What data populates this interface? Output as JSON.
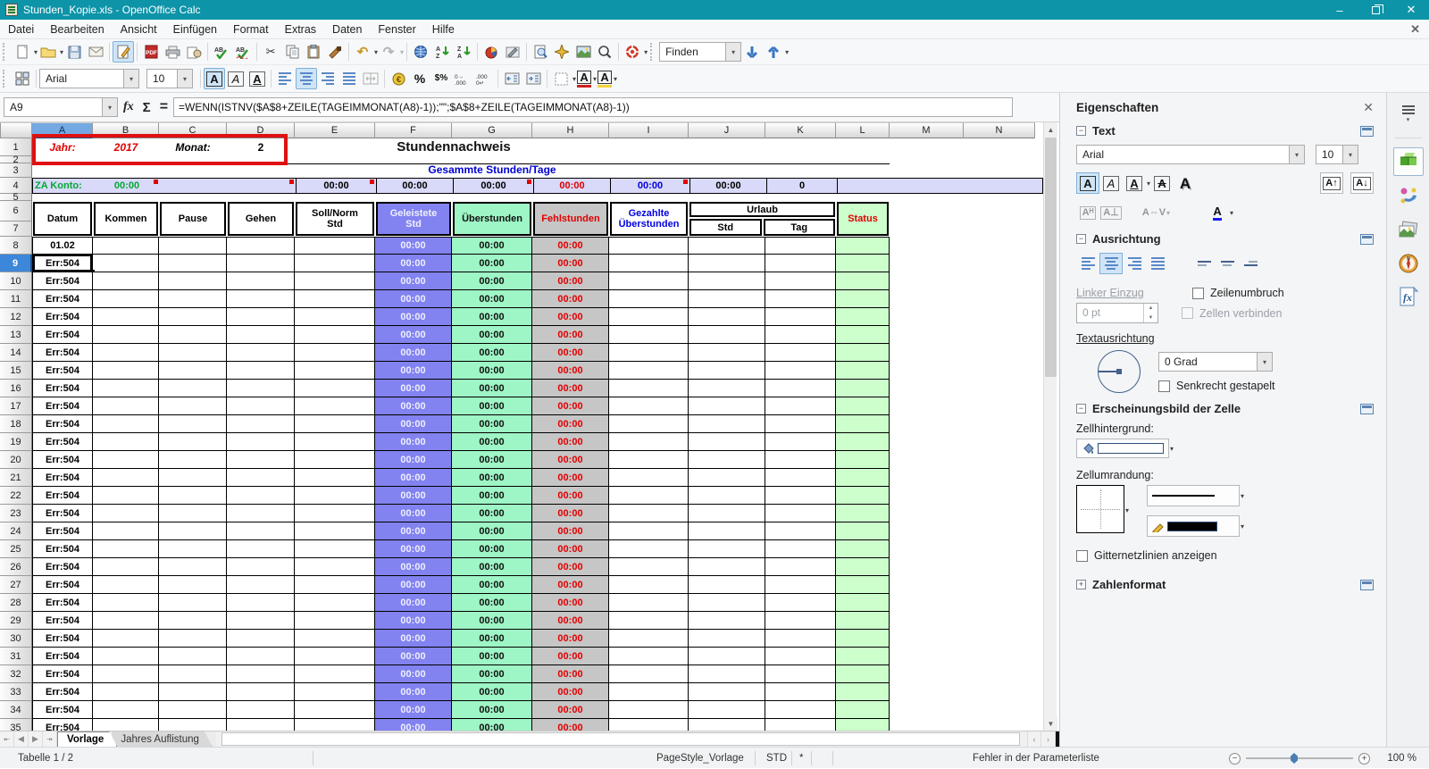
{
  "window": {
    "title": "Stunden_Kopie.xls - OpenOffice Calc"
  },
  "menu": {
    "items": [
      "Datei",
      "Bearbeiten",
      "Ansicht",
      "Einfügen",
      "Format",
      "Extras",
      "Daten",
      "Fenster",
      "Hilfe"
    ]
  },
  "toolbar1": {
    "find_placeholder": "Finden",
    "pdf_label": "PDF",
    "spell_label": "ABC"
  },
  "toolbar2": {
    "font_name": "Arial",
    "font_size": "10",
    "percent": "%",
    "currency_percent": "$%",
    "add_decimal": "000",
    "del_decimal": "000"
  },
  "formula_bar": {
    "cell_ref": "A9",
    "fx": "fx",
    "sum": "Σ",
    "equals": "=",
    "formula": "=WENN(ISTNV($A$8+ZEILE(TAGEIMMONAT(A8)-1));\"\";$A$8+ZEILE(TAGEIMMONAT(A8)-1))"
  },
  "sheet": {
    "columns": [
      "A",
      "B",
      "C",
      "D",
      "E",
      "F",
      "G",
      "H",
      "I",
      "J",
      "K",
      "L",
      "M",
      "N"
    ],
    "selected_column": "A",
    "selected_row": 9,
    "visible_rows": 35,
    "top": {
      "jahr_label": "Jahr:",
      "jahr_value": "2017",
      "monat_label": "Monat:",
      "monat_value": "2",
      "title": "Stundennachweis",
      "subtitle": "Gesammte Stunden/Tage",
      "za_label": "ZA Konto:",
      "za_value": "00:00",
      "summary": {
        "e": "00:00",
        "f": "00:00",
        "g": "00:00",
        "h": "00:00",
        "i": "00:00",
        "j": "00:00",
        "k": "0"
      }
    },
    "table_headers": {
      "datum": "Datum",
      "kommen": "Kommen",
      "pause": "Pause",
      "gehen": "Gehen",
      "soll_1": "Soll/Norm",
      "soll_2": "Std",
      "geleistete_1": "Geleistete",
      "geleistete_2": "Std",
      "ueberstunden": "Überstunden",
      "fehlstunden": "Fehlstunden",
      "gezahlte_1": "Gezahlte",
      "gezahlte_2": "Überstunden",
      "urlaub": "Urlaub",
      "urlaub_std": "Std",
      "urlaub_tag": "Tag",
      "status": "Status"
    },
    "body": {
      "first_date": "01.02",
      "error_value": "Err:504",
      "time_value": "00:00",
      "rows_from": 9,
      "rows_to": 35
    }
  },
  "sheet_tabs": {
    "tabs": [
      "Vorlage",
      "Jahres Auflistung"
    ],
    "active": "Vorlage"
  },
  "status_bar": {
    "sheet_info": "Tabelle 1 / 2",
    "page_style": "PageStyle_Vorlage",
    "mode": "STD",
    "modified_flag": "*",
    "message": "Fehler in der Parameterliste",
    "zoom_level": "100 %"
  },
  "sidebar": {
    "title": "Eigenschaften",
    "text": {
      "label": "Text",
      "font_name": "Arial",
      "font_size": "10"
    },
    "ausrichtung": {
      "label": "Ausrichtung",
      "linker_einzug_label": "Linker Einzug",
      "linker_einzug_value": "0 pt",
      "zeilenumbruch_label": "Zeilenumbruch",
      "zellen_verbinden_label": "Zellen verbinden",
      "textausrichtung_label": "Textausrichtung",
      "rotation_value": "0 Grad",
      "senkrecht_label": "Senkrecht gestapelt"
    },
    "zelle": {
      "label": "Erscheinungsbild der Zelle",
      "hintergrund_label": "Zellhintergrund:",
      "umrandung_label": "Zellumrandung:",
      "gitternetz_label": "Gitternetzlinien anzeigen"
    },
    "zahlenformat": {
      "label": "Zahlenformat"
    }
  },
  "colors": {
    "titlebar": "#0d94a8",
    "col_f_purple": "#8282f0",
    "col_g_mint": "#9ef5c5",
    "col_h_gray": "#c6c6c6",
    "status_lightgreen": "#ccffcc",
    "summary_lavender": "#d9d9f9",
    "red_text": "#e00000",
    "blue_text": "#0000e0",
    "green_text": "#00a933",
    "selection_blue": "#3c87d9",
    "annotation_red": "#e01010"
  }
}
